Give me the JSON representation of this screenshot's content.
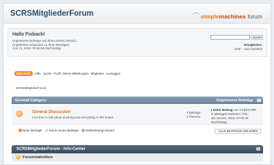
{
  "header": {
    "forum_title": "SCRSMitgliederForum",
    "logo": {
      "part1": "simple",
      "part2": "machines",
      "part3": "forum"
    }
  },
  "user": {
    "greeting": "Hallo Fisbach!",
    "line1": "Ungelesene Beiträge seit Ihrem letzten Besuch.",
    "line2": "Ungelesene Antworten zu Ihren Beiträgen.",
    "line3": "Juni 21, 2015, 05:56:58 Nachmittag"
  },
  "search": {
    "value": "",
    "button_label": "Suche"
  },
  "news": {
    "title": "Neuigkeiten:",
    "text": "SMF - Just Installed!"
  },
  "menu": [
    "Übersicht",
    "Hilfe",
    "Suche",
    "Profil",
    "Meine Mitteilungen",
    "Mitglieder",
    "Ausloggen"
  ],
  "breadcrumb": "SCRSMitgliederForum",
  "category": {
    "title": "General Category",
    "unread_link": "Ungelesene Beiträge",
    "collapse": "–"
  },
  "board": {
    "name": "General Discussion",
    "description": "Feel free to talk about anything and everything in this board.",
    "posts": "3 Beiträge",
    "topics": "3 Themen",
    "last_post": {
      "line1_label": "Letzter Beitrag",
      "line1_rest": "von YGEECARP",
      "line2": "in Mitesgeh-Gehoren / File...",
      "line3": "am Juni 03, 2015, 07:20:46 Nachmittag"
    }
  },
  "legend": [
    "Neue Beiträge",
    "Keine neuen Beiträge",
    "Weiterleitungs-Board"
  ],
  "markread_label": "ALLE BEITRÄGE GELESEN",
  "info_center": {
    "title": "SCRSMitgliederForum - Info-Center",
    "collapse": "–",
    "stats_title": "Forumstatistiken"
  }
}
